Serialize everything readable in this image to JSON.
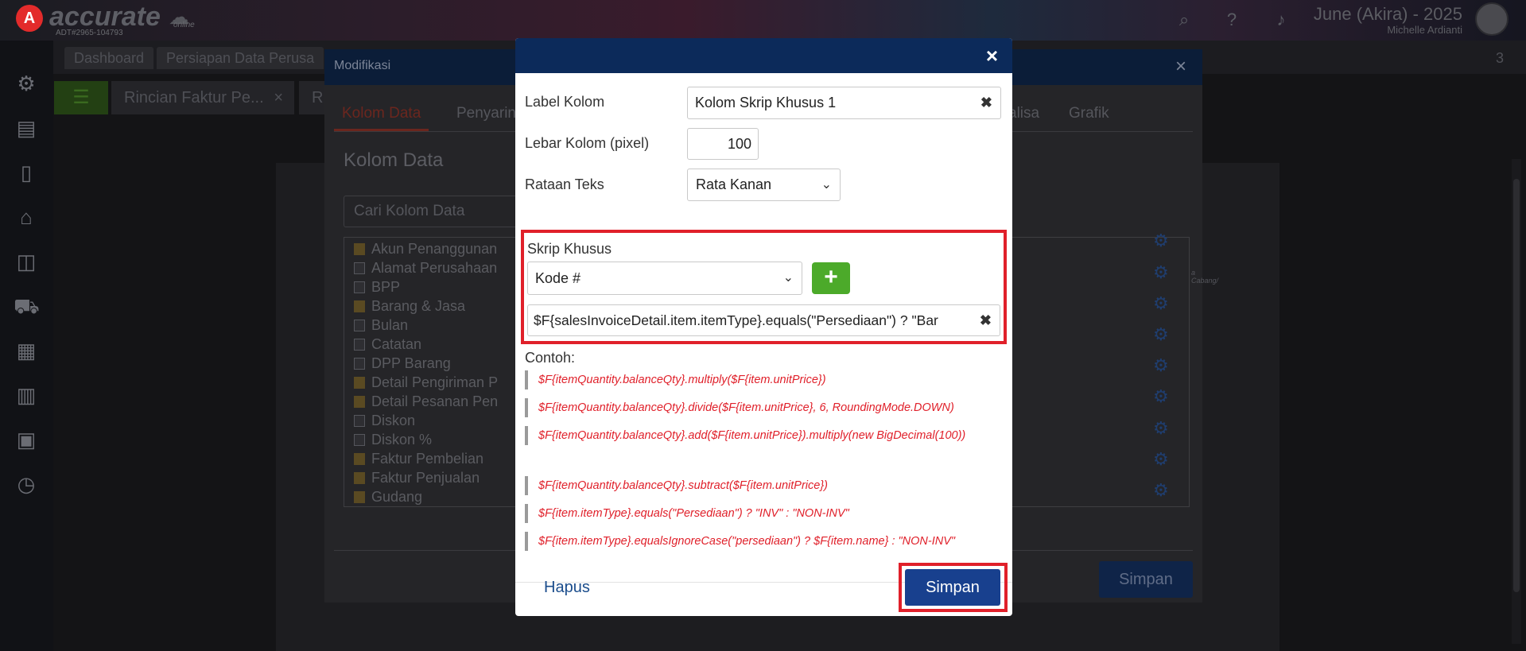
{
  "app": {
    "logo_letter": "A",
    "logo_text": "accurate",
    "logo_online": "online",
    "logo_sub": "ADT#2965-104793",
    "user_name": "June (Akira) - 2025",
    "user_sub": "Michelle Ardianti"
  },
  "tabs": {
    "dashboard": "Dashboard",
    "persiapan": "Persiapan Data Perusa",
    "rincian": "Rincian Faktur Pe...",
    "rincian_close": "×",
    "r2": "R",
    "count": "3"
  },
  "bg_dialog": {
    "title": "Modifikasi",
    "close": "×",
    "tab_kolom": "Kolom Data",
    "tab_penyaring": "Penyarin",
    "tab_analisa": "alisa",
    "tab_grafik": "Grafik",
    "section_title": "Kolom Data",
    "search_placeholder": "Cari Kolom Data",
    "cabang_note": "a Cabang/",
    "simpan": "Simpan",
    "tree": [
      {
        "label": "Akun Penanggunan",
        "type": "folder"
      },
      {
        "label": "Alamat Perusahaan",
        "type": "file"
      },
      {
        "label": "BPP",
        "type": "file"
      },
      {
        "label": "Barang & Jasa",
        "type": "folder"
      },
      {
        "label": "Bulan",
        "type": "file"
      },
      {
        "label": "Catatan",
        "type": "file"
      },
      {
        "label": "DPP Barang",
        "type": "file"
      },
      {
        "label": "Detail Pengiriman P",
        "type": "folder"
      },
      {
        "label": "Detail Pesanan Pen",
        "type": "folder"
      },
      {
        "label": "Diskon",
        "type": "file"
      },
      {
        "label": "Diskon %",
        "type": "file"
      },
      {
        "label": "Faktur Pembelian",
        "type": "folder"
      },
      {
        "label": "Faktur Penjualan",
        "type": "folder"
      },
      {
        "label": "Gudang",
        "type": "folder"
      }
    ]
  },
  "modal": {
    "close": "×",
    "label_kolom": "Label Kolom",
    "label_value": "Kolom Skrip Khusus 1",
    "lebar_kolom": "Lebar Kolom (pixel)",
    "lebar_value": "100",
    "rataan_teks": "Rataan Teks",
    "rataan_value": "Rata Kanan",
    "skrip_khusus": "Skrip Khusus",
    "kode_value": "Kode #",
    "add_label": "+",
    "script_value": "$F{salesInvoiceDetail.item.itemType}.equals(\"Persediaan\") ? \"Bar",
    "contoh": "Contoh:",
    "examples": [
      "$F{itemQuantity.balanceQty}.multiply($F{item.unitPrice})",
      "$F{itemQuantity.balanceQty}.divide($F{item.unitPrice}, 6, RoundingMode.DOWN)",
      "$F{itemQuantity.balanceQty}.add($F{item.unitPrice}).multiply(new BigDecimal(100))",
      "$F{itemQuantity.balanceQty}.subtract($F{item.unitPrice})",
      "$F{item.itemType}.equals(\"Persediaan\") ? \"INV\" : \"NON-INV\"",
      "$F{item.itemType}.equalsIgnoreCase(\"persediaan\") ? $F{item.name} : \"NON-INV\""
    ],
    "hapus": "Hapus",
    "simpan": "Simpan"
  },
  "icons": {
    "topbar": [
      "search-icon",
      "help-icon",
      "bell-icon"
    ],
    "sidebar": [
      "gear-icon",
      "building-icon",
      "book-icon",
      "bank-icon",
      "bag-icon",
      "cart-icon",
      "truck-icon",
      "factory-icon",
      "report-icon",
      "clock-icon"
    ]
  },
  "colors": {
    "highlight": "#e0202a",
    "primary": "#18408e",
    "add_green": "#4caa2a",
    "example_red": "#e0202a",
    "modal_header": "#0c2a5a"
  }
}
